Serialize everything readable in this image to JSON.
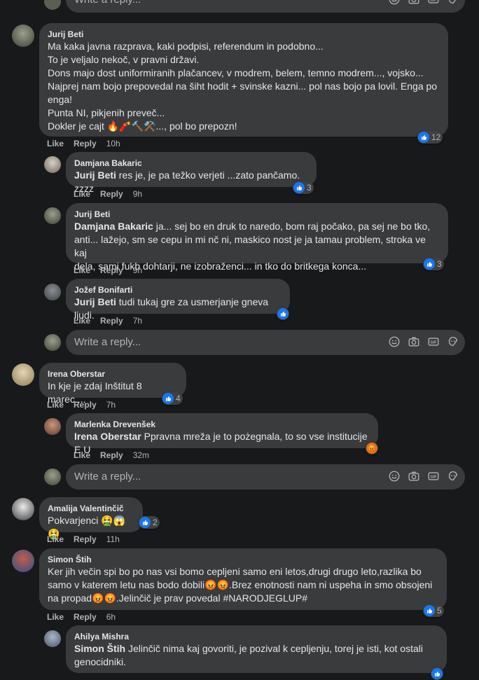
{
  "composer": {
    "placeholder": "Write a reply..."
  },
  "comments": [
    {
      "author": "Jurij Beti",
      "lines": [
        "Ma kaka javna razprava, kaki podpisi, referendum in podobno...",
        "To je veljalo nekoč, v pravni državi.",
        "Dons majo dost uniformiranih plačancev, v modrem, belem, temno modrem..., vojsko...",
        "Najprej nam bojo prepovedal na šiht hodit + svinske kazni... pol nas bojo pa lovil. Enga po",
        "enga!",
        "Punta NI, pikjenih preveč...",
        "Dokler je cajt 🔥🧨🔨⚒️..., pol bo prepozn!"
      ],
      "like": "Like",
      "reply": "Reply",
      "time": "10h",
      "reactions": "12",
      "replies": [
        {
          "author": "Damjana Bakaric",
          "mention": "Jurij Beti",
          "text": " res je, je pa težko verjeti ...zato pančamo. zzzz",
          "like": "Like",
          "reply": "Reply",
          "time": "9h",
          "reactions": "3"
        },
        {
          "author": "Jurij Beti",
          "mention": "Damjana Bakaric",
          "text": " ja... sej bo en druk to naredo, bom raj počako, pa sej ne bo tko,",
          "lines2": [
            "anti... lažejo, sm se cepu in mi nč ni, maskico nost je ja tamau problem, stroka ve kaj",
            "dela, sami fukb dohtarji, ne izobraženci... in tko do britkega konca..."
          ],
          "like": "Like",
          "reply": "Reply",
          "time": "9h",
          "reactions": "3"
        },
        {
          "author": "Jožef Bonifarti",
          "mention": "Jurij Beti",
          "text": " tudi tukaj gre za usmerjanje gneva ljudi.",
          "like": "Like",
          "reply": "Reply",
          "time": "7h",
          "reactions": ""
        }
      ]
    },
    {
      "author": "Irena Oberstar",
      "text": "In kje je zdaj Inštitut 8 marec....",
      "like": "Like",
      "reply": "Reply",
      "time": "7h",
      "reactions": "4",
      "replies": [
        {
          "author": "Marlenka Drevenšek",
          "mention": "Irena Oberstar",
          "text": " Ppravna mreža je to pożegnala, to so vse institucije E U",
          "like": "Like",
          "reply": "Reply",
          "time": "32m"
        }
      ]
    },
    {
      "author": "Amalija Valentinčič",
      "text": "Pokvarjenci 🤮😱🤮",
      "like": "Like",
      "reply": "Reply",
      "time": "11h",
      "reactions": "2"
    },
    {
      "author": "Simon Štih",
      "lines": [
        "Ker jih večin spi bo po nas vsi bomo cepljeni samo eni letos,drugi drugo leto,razlika bo",
        "samo v katerem letu nas bodo dobili😡😡.Brez enotnosti nam ni uspeha in smo obsojeni",
        "na propad😡😡.Jelinčič je prav povedal #NARODJEGLUP#"
      ],
      "like": "Like",
      "reply": "Reply",
      "time": "6h",
      "reactions": "5",
      "replies": [
        {
          "author": "Ahilya Mishra",
          "mention": "Simon Štih",
          "text": " Jelinčič nima kaj govoriti, je pozival k cepljenju, torej je isti, kot ostali",
          "lines2": [
            "genocidniki."
          ]
        }
      ]
    }
  ],
  "colors": {
    "bg": "#18191a",
    "bubble": "#3a3b3c",
    "like": "#1877f2",
    "angry": "#e9710f"
  }
}
